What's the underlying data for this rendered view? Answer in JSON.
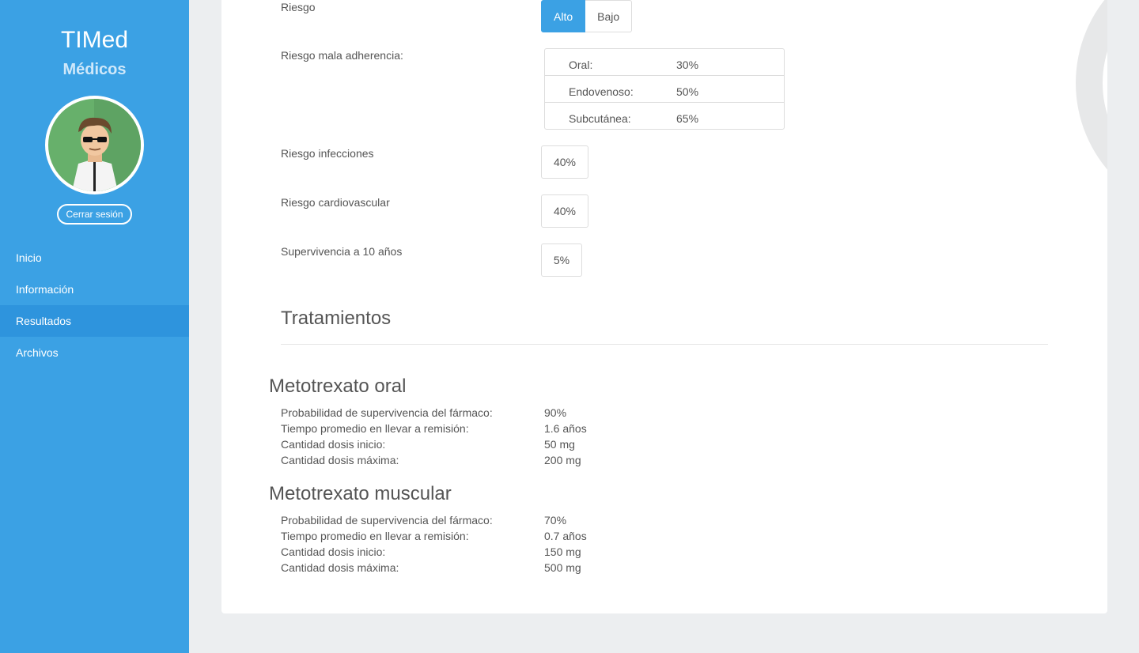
{
  "sidebar": {
    "brand": "TIMed",
    "subbrand": "Médicos",
    "logout_label": "Cerrar sesión",
    "nav": [
      {
        "label": "Inicio",
        "active": false
      },
      {
        "label": "Información",
        "active": false
      },
      {
        "label": "Resultados",
        "active": true
      },
      {
        "label": "Archivos",
        "active": false
      }
    ]
  },
  "results": {
    "riesgo": {
      "label": "Riesgo",
      "options": [
        "Alto",
        "Bajo"
      ],
      "selected": "Alto"
    },
    "adherencia": {
      "label": "Riesgo mala adherencia:",
      "rows": [
        {
          "key": "Oral:",
          "value": "30%"
        },
        {
          "key": "Endovenoso:",
          "value": "50%"
        },
        {
          "key": "Subcutánea:",
          "value": "65%"
        }
      ]
    },
    "infecciones": {
      "label": "Riesgo infecciones",
      "value": "40%"
    },
    "cardiovascular": {
      "label": "Riesgo cardiovascular",
      "value": "40%"
    },
    "supervivencia": {
      "label": "Supervivencia a 10 años",
      "value": "5%"
    }
  },
  "tratamientos": {
    "title": "Tratamientos",
    "drugs": [
      {
        "name": "Metotrexato oral",
        "rows": [
          {
            "key": "Probabilidad de supervivencia del fármaco:",
            "value": "90%"
          },
          {
            "key": "Tiempo promedio en llevar a remisión:",
            "value": "1.6 años"
          },
          {
            "key": "Cantidad dosis inicio:",
            "value": "50 mg"
          },
          {
            "key": "Cantidad dosis máxima:",
            "value": "200 mg"
          }
        ]
      },
      {
        "name": "Metotrexato muscular",
        "rows": [
          {
            "key": "Probabilidad de supervivencia del fármaco:",
            "value": "70%"
          },
          {
            "key": "Tiempo promedio en llevar a remisión:",
            "value": "0.7 años"
          },
          {
            "key": "Cantidad dosis inicio:",
            "value": "150 mg"
          },
          {
            "key": "Cantidad dosis máxima:",
            "value": "500 mg"
          }
        ]
      }
    ]
  },
  "colors": {
    "sidebar": "#3ba1e4",
    "active_nav": "#2e94dd",
    "background": "#eceef0"
  },
  "icons": [
    "doctor-avatar-icon",
    "magnifier-watermark-icon"
  ]
}
